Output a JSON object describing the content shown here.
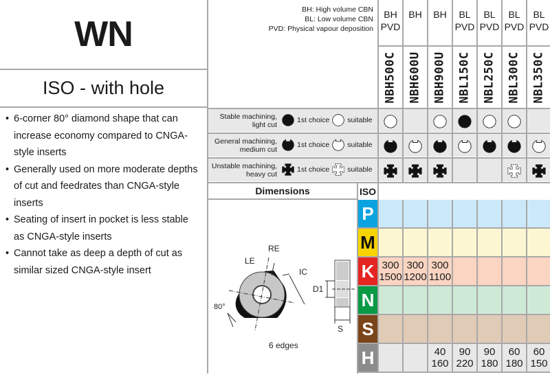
{
  "title": "WN",
  "subtitle": "ISO - with hole",
  "bullets": [
    "6-corner 80° diamond shape that can increase economy compared to CNGA-style inserts",
    "Generally used on more moderate depths of cut and feedrates than CNGA-style inserts",
    "Seating of insert in pocket is less stable as CNGA-style inserts",
    "Cannot take as deep a depth of cut as similar sized CNGA-style insert"
  ],
  "legend": [
    "BH: High volume CBN",
    "BL: Low volume CBN",
    "PVD: Physical vapour deposition"
  ],
  "grades": [
    {
      "type": "BH",
      "coat": "PVD",
      "name": "NBH500C"
    },
    {
      "type": "BH",
      "coat": "",
      "name": "NBH600U"
    },
    {
      "type": "BH",
      "coat": "",
      "name": "NBH900U"
    },
    {
      "type": "BL",
      "coat": "PVD",
      "name": "NBL150C"
    },
    {
      "type": "BL",
      "coat": "PVD",
      "name": "NBL250C"
    },
    {
      "type": "BL",
      "coat": "PVD",
      "name": "NBL300C"
    },
    {
      "type": "BL",
      "coat": "PVD",
      "name": "NBL350C"
    }
  ],
  "conditions": [
    {
      "label1": "Stable machining,",
      "label2": "light cut",
      "shape": "circle",
      "first": "1st choice",
      "suitable": "suitable",
      "values": [
        "suitable",
        null,
        "suitable",
        "first",
        "suitable",
        "suitable",
        null
      ]
    },
    {
      "label1": "General machining,",
      "label2": "medium cut",
      "shape": "notch",
      "first": "1st choice",
      "suitable": "suitable",
      "values": [
        "first",
        "suitable",
        "first",
        "suitable",
        "first",
        "first",
        "suitable"
      ]
    },
    {
      "label1": "Unstable machining,",
      "label2": "heavy cut",
      "shape": "cross",
      "first": "1st choice",
      "suitable": "suitable",
      "values": [
        "first",
        "first",
        "first",
        null,
        null,
        "suitable",
        "first"
      ]
    }
  ],
  "dimensions": {
    "header": "Dimensions",
    "labels": {
      "re": "RE",
      "le": "LE",
      "ic": "IC",
      "d1": "D1",
      "s": "S",
      "angle": "80°"
    },
    "edges": "6 edges"
  },
  "iso_header": "ISO",
  "iso": [
    {
      "letter": "P",
      "color": "#0aa3e0",
      "bg": "#cce9f9",
      "values": [
        null,
        null,
        null,
        null,
        null,
        null,
        null
      ]
    },
    {
      "letter": "M",
      "color": "#f7d300",
      "text": "#111",
      "bg": "#fdf6d2",
      "values": [
        null,
        null,
        null,
        null,
        null,
        null,
        null
      ]
    },
    {
      "letter": "K",
      "color": "#e52521",
      "bg": "#fbd5c2",
      "values": [
        [
          "300",
          "1500"
        ],
        [
          "300",
          "1200"
        ],
        [
          "300",
          "1100"
        ],
        null,
        null,
        null,
        null
      ]
    },
    {
      "letter": "N",
      "color": "#0a9a46",
      "bg": "#cfe9d7",
      "values": [
        null,
        null,
        null,
        null,
        null,
        null,
        null
      ]
    },
    {
      "letter": "S",
      "color": "#7a4518",
      "bg": "#e0cbb7",
      "values": [
        null,
        null,
        null,
        null,
        null,
        null,
        null
      ]
    },
    {
      "letter": "H",
      "color": "#8c8c8c",
      "bg": "#e8e8e8",
      "values": [
        null,
        null,
        [
          "40",
          "160"
        ],
        [
          "90",
          "220"
        ],
        [
          "90",
          "180"
        ],
        [
          "60",
          "180"
        ],
        [
          "60",
          "150"
        ]
      ]
    }
  ]
}
